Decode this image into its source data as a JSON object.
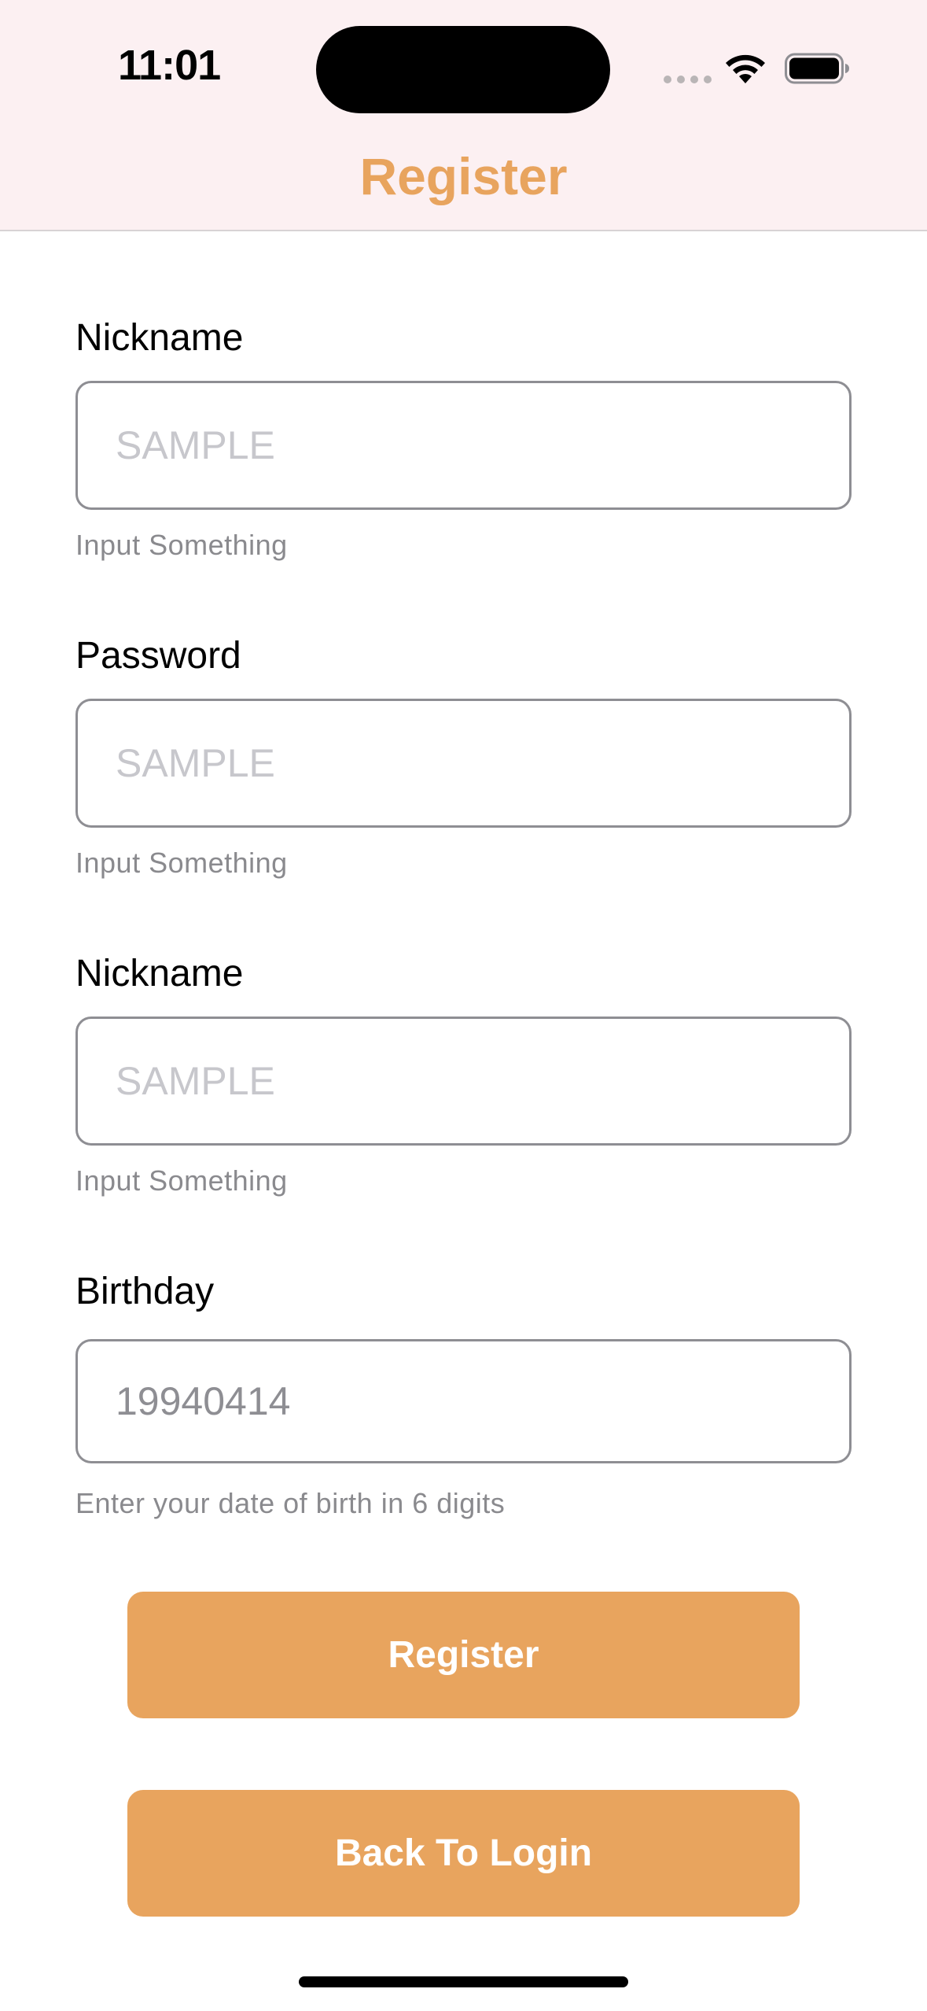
{
  "status_bar": {
    "time": "11:01"
  },
  "nav": {
    "title": "Register"
  },
  "form": {
    "fields": [
      {
        "label": "Nickname",
        "placeholder": "SAMPLE",
        "hint": "Input Something"
      },
      {
        "label": "Password",
        "placeholder": "SAMPLE",
        "hint": "Input Something"
      },
      {
        "label": "Nickname",
        "placeholder": "SAMPLE",
        "hint": "Input Something"
      },
      {
        "label": "Birthday",
        "placeholder": "19940414",
        "hint": "Enter your date of birth in 6 digits"
      }
    ]
  },
  "buttons": {
    "register_label": "Register",
    "back_label": "Back To Login"
  },
  "colors": {
    "accent": "#e8a45e",
    "header_bg": "#fcf0f2"
  }
}
